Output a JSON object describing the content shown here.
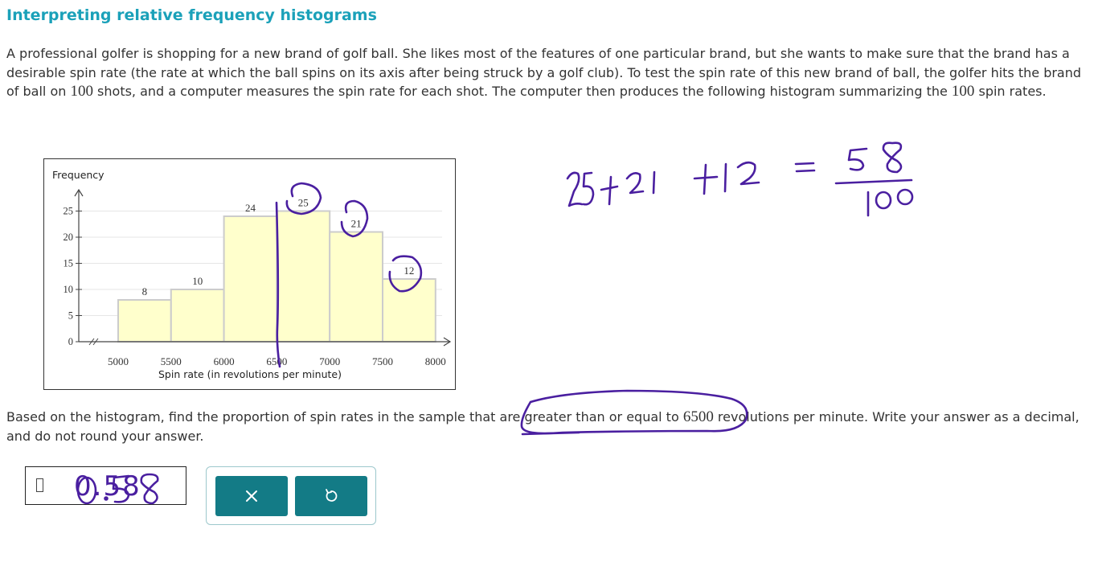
{
  "header": {
    "title": "Interpreting relative frequency histograms"
  },
  "problem": {
    "part1": "A professional golfer is shopping for a new brand of golf ball. She likes most of the features of one particular brand, but she wants to make sure that the brand has a desirable spin rate (the rate at which the ball spins on its axis after being struck by a golf club). To test the spin rate of this new brand of ball, the golfer hits the brand of ball on ",
    "n1": "100",
    "part2": " shots, and a computer measures the spin rate for each shot. The computer then produces the following histogram summarizing the ",
    "n2": "100",
    "part3": " spin rates."
  },
  "question": {
    "part1": "Based on the histogram, find the proportion of spin rates in the sample that are greater than or equal to ",
    "n1": "6500",
    "part2": " revolutions per minute. Write your answer as a decimal, and do not round your answer."
  },
  "answer": {
    "value": "0.58"
  },
  "buttons": {
    "clear_icon": "close-icon",
    "undo_icon": "undo-icon"
  },
  "handwriting": {
    "sum": "25+21+12",
    "numerator": "58",
    "denominator": "100"
  },
  "colors": {
    "accent": "#1ba1b9",
    "bar_fill": "#ffffcc",
    "bar_stroke": "#cccccc",
    "button": "#137b86",
    "ink": "#4a1fa0"
  },
  "chart_data": {
    "type": "bar",
    "ylabel": "Frequency",
    "xlabel": "Spin rate (in revolutions per minute)",
    "x_ticks": [
      5000,
      5500,
      6000,
      6500,
      7000,
      7500,
      8000
    ],
    "y_ticks": [
      0,
      5,
      10,
      15,
      20,
      25
    ],
    "ylim": [
      0,
      28
    ],
    "bins": [
      {
        "from": 5000,
        "to": 5500,
        "value": 8
      },
      {
        "from": 5500,
        "to": 6000,
        "value": 10
      },
      {
        "from": 6000,
        "to": 6500,
        "value": 24
      },
      {
        "from": 6500,
        "to": 7000,
        "value": 25
      },
      {
        "from": 7000,
        "to": 7500,
        "value": 21
      },
      {
        "from": 7500,
        "to": 8000,
        "value": 12
      }
    ],
    "grid": true,
    "axis_break": true
  }
}
